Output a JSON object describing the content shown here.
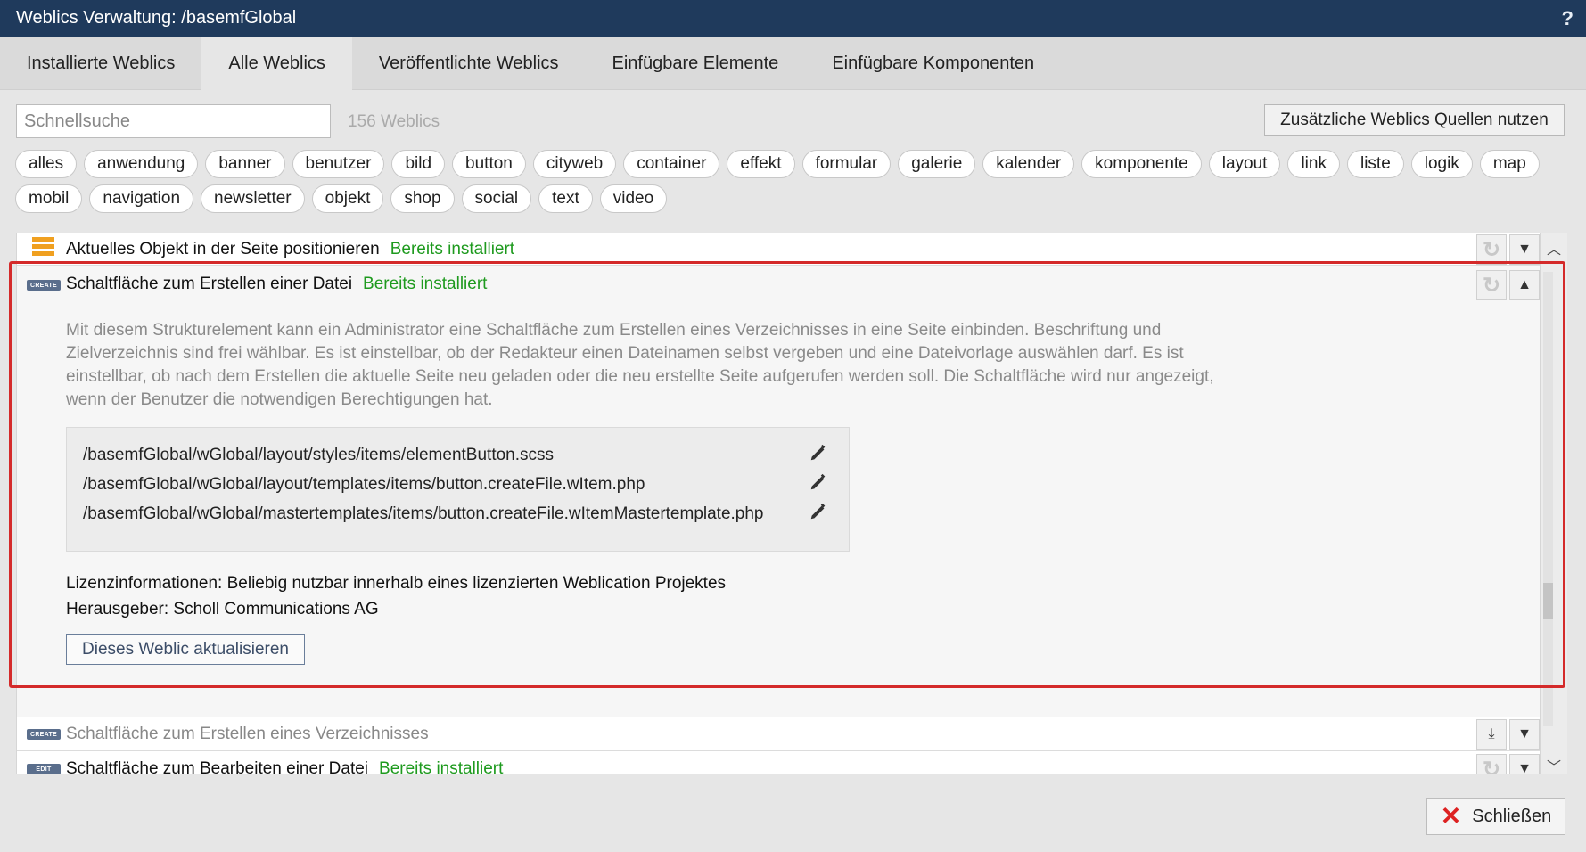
{
  "window": {
    "title": "Weblics Verwaltung: /basemfGlobal",
    "help": "?"
  },
  "tabs": [
    {
      "label": "Installierte Weblics"
    },
    {
      "label": "Alle Weblics"
    },
    {
      "label": "Veröffentlichte Weblics"
    },
    {
      "label": "Einfügbare Elemente"
    },
    {
      "label": "Einfügbare Komponenten"
    }
  ],
  "active_tab": "Alle Weblics",
  "search": {
    "placeholder": "Schnellsuche",
    "value": ""
  },
  "count": "156 Weblics",
  "extra_sources_button": "Zusätzliche Weblics Quellen nutzen",
  "filters": [
    "alles",
    "anwendung",
    "banner",
    "benutzer",
    "bild",
    "button",
    "cityweb",
    "container",
    "effekt",
    "formular",
    "galerie",
    "kalender",
    "komponente",
    "layout",
    "link",
    "liste",
    "logik",
    "map",
    "mobil",
    "navigation",
    "newsletter",
    "objekt",
    "shop",
    "social",
    "text",
    "video"
  ],
  "items": [
    {
      "title": "Aktuelles Objekt in der Seite positionieren",
      "status": "Bereits installiert",
      "icon": "bars-icon"
    },
    {
      "title": "Schaltfläche zum Erstellen einer Datei",
      "status": "Bereits installiert",
      "badge": "CREATE",
      "description": "Mit diesem Strukturelement kann ein Administrator eine Schaltfläche zum Erstellen eines Verzeichnisses in eine Seite einbinden. Beschriftung und Zielverzeichnis sind frei wählbar. Es ist einstellbar, ob der Redakteur einen Dateinamen selbst vergeben und eine Dateivorlage auswählen darf. Es ist einstellbar, ob nach dem Erstellen die aktuelle Seite neu geladen oder die neu erstellte Seite aufgerufen werden soll. Die Schaltfläche wird nur angezeigt, wenn der Benutzer die notwendigen Berechtigungen hat.",
      "files": [
        "/basemfGlobal/wGlobal/layout/styles/items/elementButton.scss",
        "/basemfGlobal/wGlobal/layout/templates/items/button.createFile.wItem.php",
        "/basemfGlobal/wGlobal/mastertemplates/items/button.createFile.wItemMastertemplate.php"
      ],
      "license": "Lizenzinformationen: Beliebig nutzbar innerhalb eines lizenzierten Weblication Projektes",
      "publisher": "Herausgeber: Scholl Communications AG",
      "update_button": "Dieses Weblic aktualisieren"
    },
    {
      "title": "Schaltfläche zum Erstellen eines Verzeichnisses",
      "status": "",
      "badge": "CREATE"
    },
    {
      "title": "Schaltfläche zum Bearbeiten einer Datei",
      "status": "Bereits installiert",
      "badge": "EDIT"
    }
  ],
  "close_button": "Schließen",
  "colors": {
    "titlebar": "#1f3a5c",
    "installed": "#1e9a1e",
    "highlight": "#d42a2a"
  }
}
